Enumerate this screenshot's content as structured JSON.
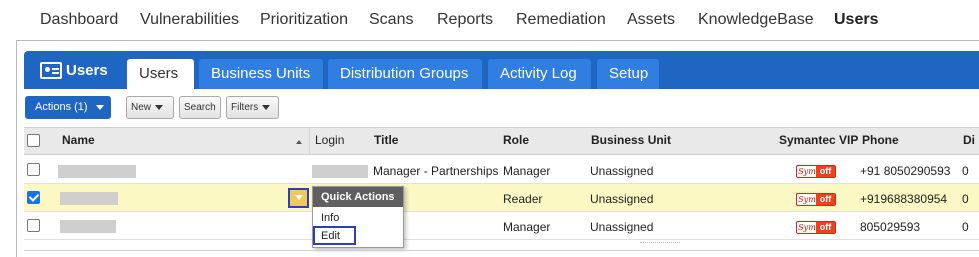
{
  "topnav": {
    "items": [
      "Dashboard",
      "Vulnerabilities",
      "Prioritization",
      "Scans",
      "Reports",
      "Remediation",
      "Assets",
      "KnowledgeBase",
      "Users"
    ],
    "active": "Users"
  },
  "app": {
    "title": "Users",
    "icon": "id-card-icon"
  },
  "tabs": [
    "Users",
    "Business Units",
    "Distribution Groups",
    "Activity Log",
    "Setup"
  ],
  "toolbar": {
    "actions_label": "Actions (1)",
    "new_label": "New",
    "search_label": "Search",
    "filters_label": "Filters"
  },
  "table": {
    "columns": [
      "Name",
      "Login",
      "Title",
      "Role",
      "Business Unit",
      "Symantec VIP",
      "Phone",
      "Di"
    ],
    "rows": [
      {
        "checked": false,
        "title": "Manager - Partnerships",
        "role": "Manager",
        "business_unit": "Unassigned",
        "vip": "off",
        "phone": "+91 8050290593",
        "extra": "0"
      },
      {
        "checked": true,
        "title": "",
        "role": "Reader",
        "business_unit": "Unassigned",
        "vip": "off",
        "phone": "+919688380954",
        "extra": "0"
      },
      {
        "checked": false,
        "title": "",
        "role": "Manager",
        "business_unit": "Unassigned",
        "vip": "off",
        "phone": "805029593",
        "extra": "0"
      }
    ]
  },
  "quick_actions": {
    "header": "Quick Actions",
    "items": [
      "Info",
      "Edit"
    ]
  },
  "colors": {
    "brand_blue": "#1f66c3",
    "tab_blue": "#2f7ee0",
    "selected_row": "#fbf8c4",
    "highlight_border": "#2c3fb8"
  }
}
